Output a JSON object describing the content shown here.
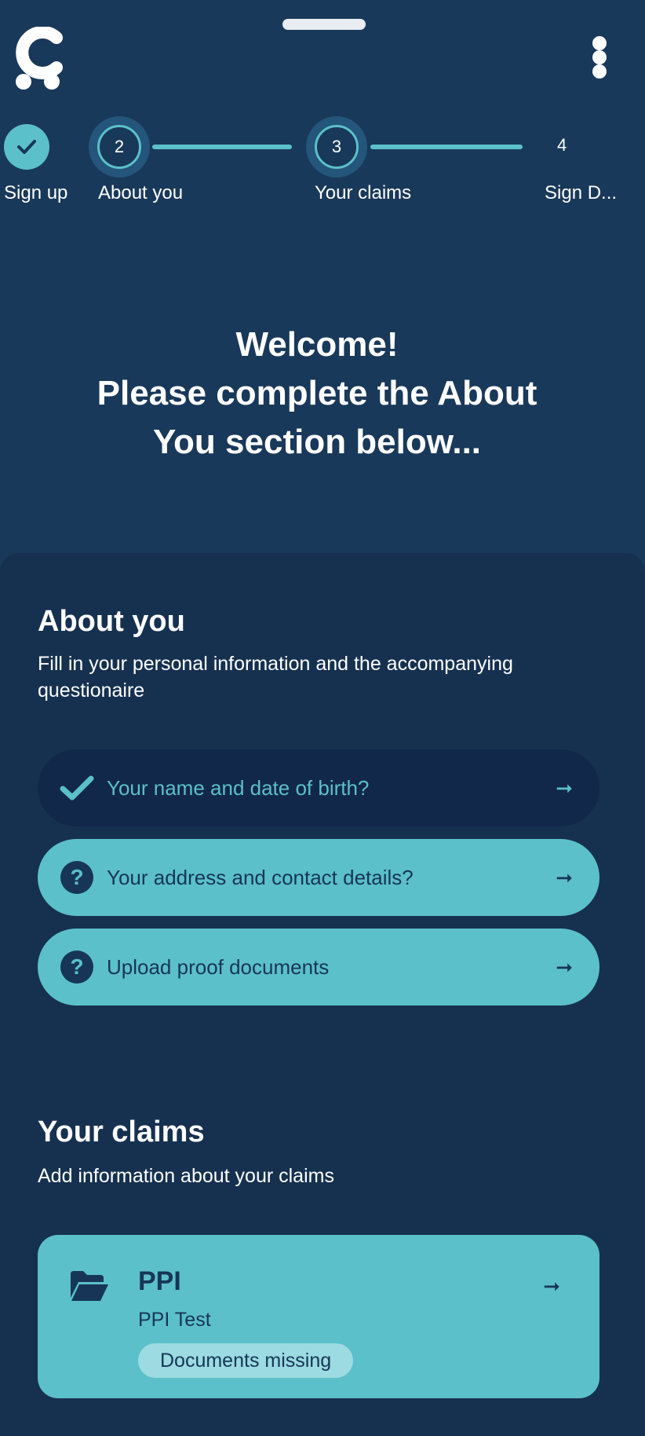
{
  "stepper": {
    "steps": [
      {
        "number": "",
        "label": "Sign up",
        "state": "done"
      },
      {
        "number": "2",
        "label": "About you",
        "state": "active"
      },
      {
        "number": "3",
        "label": "Your claims",
        "state": "active"
      },
      {
        "number": "4",
        "label": "Sign D...",
        "state": "upcoming"
      }
    ]
  },
  "welcome": {
    "line1": "Welcome!",
    "line2": "Please complete the About",
    "line3": "You section below..."
  },
  "about": {
    "title": "About you",
    "subtitle": "Fill in your personal information and the accompanying questionaire",
    "tasks": [
      {
        "label": "Your name and date of birth?",
        "status": "done",
        "icon": "check-icon"
      },
      {
        "label": "Your address and contact details?",
        "status": "todo",
        "icon": "question-icon"
      },
      {
        "label": "Upload proof documents",
        "status": "todo",
        "icon": "question-icon"
      }
    ],
    "arrow": "➞"
  },
  "claims": {
    "title": "Your claims",
    "subtitle": "Add information about your claims",
    "items": [
      {
        "title": "PPI",
        "subtitle": "PPI Test",
        "badge": "Documents missing",
        "icon": "folder-open-icon"
      }
    ]
  },
  "colors": {
    "background": "#19395a",
    "accent": "#5bc0c9",
    "card": "#163150",
    "done_task": "#12284a"
  }
}
